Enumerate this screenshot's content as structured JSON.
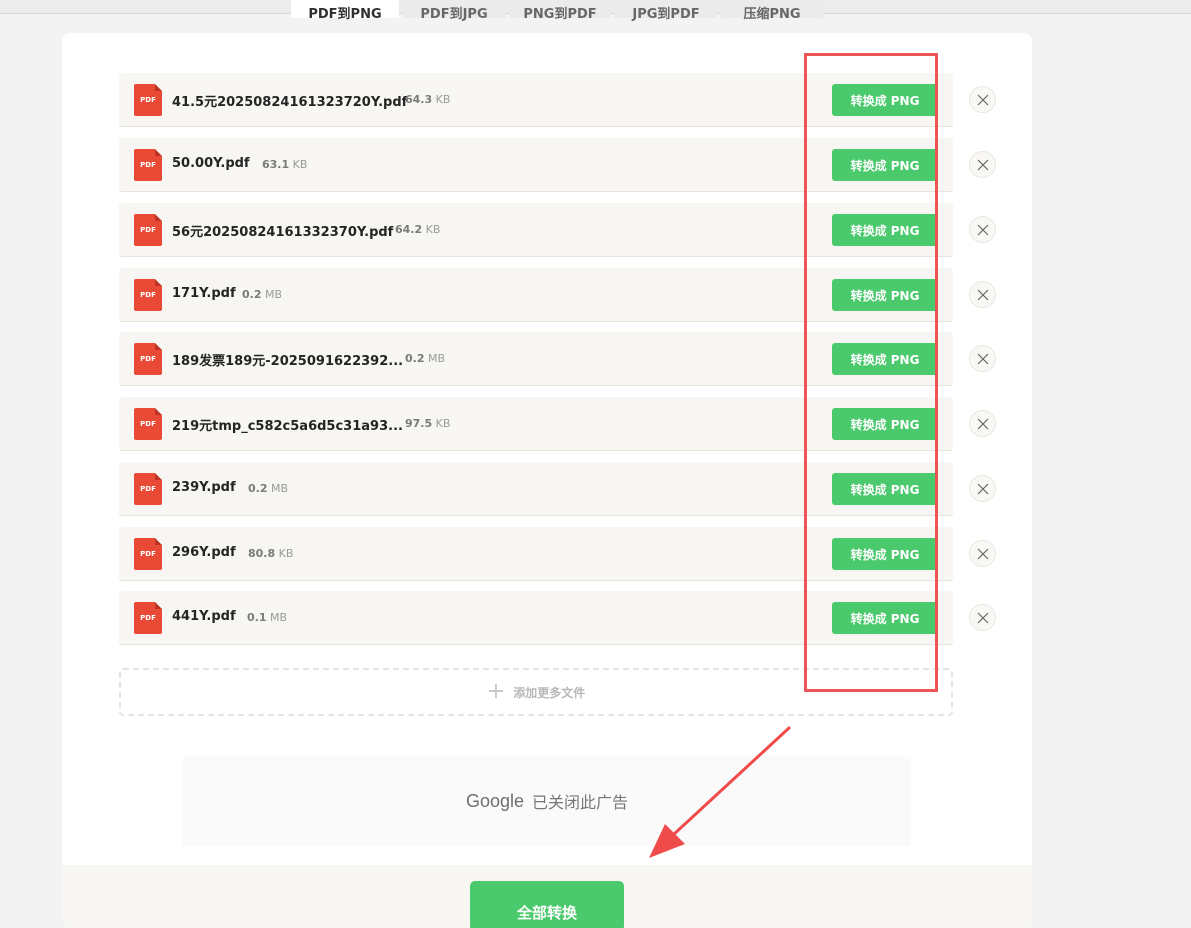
{
  "tabs": [
    {
      "label": "PDF到PNG"
    },
    {
      "label": "PDF到JPG"
    },
    {
      "label": "PNG到PDF"
    },
    {
      "label": "JPG到PDF"
    },
    {
      "label": "压缩PNG"
    }
  ],
  "file_icon_label": "PDF",
  "convert_label": "转换成 PNG",
  "files": [
    {
      "name": "41.5元20250824161323720Y.pdf",
      "size_value": "64.3",
      "size_unit": "KB"
    },
    {
      "name": "50.00Y.pdf",
      "size_value": "63.1",
      "size_unit": "KB"
    },
    {
      "name": "56元20250824161332370Y.pdf",
      "size_value": "64.2",
      "size_unit": "KB"
    },
    {
      "name": "171Y.pdf",
      "size_value": "0.2",
      "size_unit": "MB"
    },
    {
      "name": "189发票189元-2025091622392...",
      "size_value": "0.2",
      "size_unit": "MB"
    },
    {
      "name": "219元tmp_c582c5a6d5c31a93...",
      "size_value": "97.5",
      "size_unit": "KB"
    },
    {
      "name": "239Y.pdf",
      "size_value": "0.2",
      "size_unit": "MB"
    },
    {
      "name": "296Y.pdf",
      "size_value": "80.8",
      "size_unit": "KB"
    },
    {
      "name": "441Y.pdf",
      "size_value": "0.1",
      "size_unit": "MB"
    }
  ],
  "add_more_label": "添加更多文件",
  "ad": {
    "brand": "Google",
    "message": "已关闭此广告"
  },
  "convert_all_label": "全部转换",
  "colors": {
    "accent": "#4bc96d",
    "pdf_red": "#e94a35",
    "annotation": "#ef5454"
  },
  "icons": {
    "file": "pdf-file-icon",
    "remove": "close-icon",
    "add": "plus-icon",
    "annotation_arrow": "arrow-icon"
  }
}
